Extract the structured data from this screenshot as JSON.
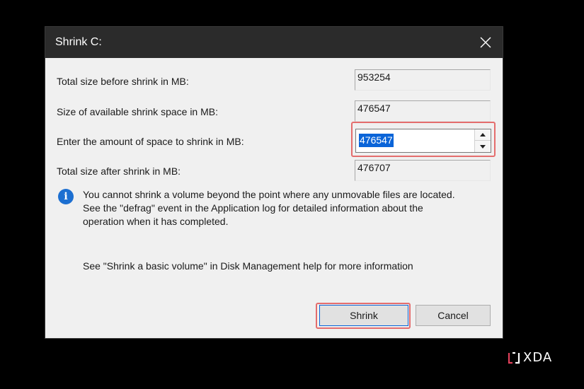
{
  "dialog": {
    "title": "Shrink C:",
    "close_icon": "close-icon"
  },
  "fields": {
    "total_before": {
      "label": "Total size before shrink in MB:",
      "value": "953254"
    },
    "available": {
      "label": "Size of available shrink space in MB:",
      "value": "476547"
    },
    "amount": {
      "label": "Enter the amount of space to shrink in MB:",
      "value": "476547"
    },
    "total_after": {
      "label": "Total size after shrink in MB:",
      "value": "476707"
    }
  },
  "info": {
    "icon": "info-icon",
    "line1": "You cannot shrink a volume beyond the point where any unmovable files are located.",
    "line2": "See the \"defrag\" event in the Application log for detailed information about the",
    "line3": "operation when it has completed."
  },
  "help_text": "See \"Shrink a basic volume\" in Disk Management help for more information",
  "buttons": {
    "shrink": "Shrink",
    "cancel": "Cancel"
  },
  "watermark": {
    "text": "XDA"
  },
  "colors": {
    "highlight": "#e46d6d",
    "selection": "#0a64d8",
    "info_icon": "#1c6fd1",
    "titlebar": "#2b2b2b",
    "dialog_bg": "#f0f0f0",
    "watermark_accent": "#e0405a"
  }
}
